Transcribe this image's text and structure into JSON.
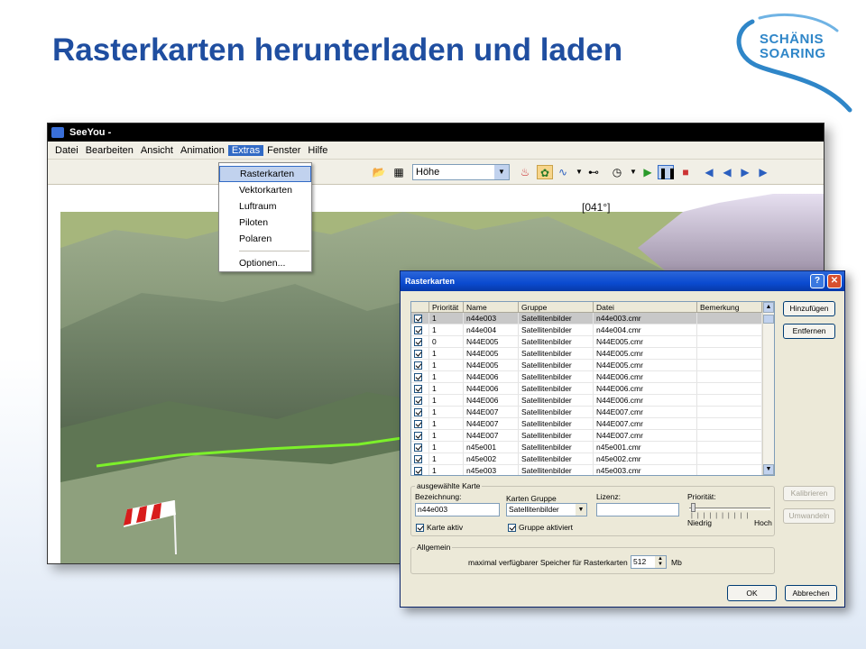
{
  "slide": {
    "title": "Rasterkarten herunterladen und laden",
    "logo_line1": "SCHÄNIS",
    "logo_line2": "SOARING"
  },
  "app": {
    "title": "SeeYou -",
    "menu": [
      "Datei",
      "Bearbeiten",
      "Ansicht",
      "Animation",
      "Extras",
      "Fenster",
      "Hilfe"
    ],
    "active_menu": "Extras",
    "toolbar_select_value": "Höhe",
    "compass_label": "[041°]"
  },
  "extras_menu": {
    "items": [
      "Rasterkarten",
      "Vektorkarten",
      "Luftraum",
      "Piloten",
      "Polaren"
    ],
    "after_separator": "Optionen...",
    "highlighted": "Rasterkarten"
  },
  "dialog": {
    "title": "Rasterkarten",
    "help_button": "?",
    "close_button": "✕",
    "columns": [
      "",
      "Priorität",
      "Name",
      "Gruppe",
      "Datei",
      "Bemerkung"
    ],
    "rows": [
      {
        "checked": true,
        "prio": "1",
        "name": "n44e003",
        "gruppe": "Satellitenbilder",
        "datei": "n44e003.cmr",
        "bemerkung": ""
      },
      {
        "checked": true,
        "prio": "1",
        "name": "n44e004",
        "gruppe": "Satellitenbilder",
        "datei": "n44e004.cmr",
        "bemerkung": ""
      },
      {
        "checked": true,
        "prio": "0",
        "name": "N44E005",
        "gruppe": "Satellitenbilder",
        "datei": "N44E005.cmr",
        "bemerkung": ""
      },
      {
        "checked": true,
        "prio": "1",
        "name": "N44E005",
        "gruppe": "Satellitenbilder",
        "datei": "N44E005.cmr",
        "bemerkung": ""
      },
      {
        "checked": true,
        "prio": "1",
        "name": "N44E005",
        "gruppe": "Satellitenbilder",
        "datei": "N44E005.cmr",
        "bemerkung": ""
      },
      {
        "checked": true,
        "prio": "1",
        "name": "N44E006",
        "gruppe": "Satellitenbilder",
        "datei": "N44E006.cmr",
        "bemerkung": ""
      },
      {
        "checked": true,
        "prio": "1",
        "name": "N44E006",
        "gruppe": "Satellitenbilder",
        "datei": "N44E006.cmr",
        "bemerkung": ""
      },
      {
        "checked": true,
        "prio": "1",
        "name": "N44E006",
        "gruppe": "Satellitenbilder",
        "datei": "N44E006.cmr",
        "bemerkung": ""
      },
      {
        "checked": true,
        "prio": "1",
        "name": "N44E007",
        "gruppe": "Satellitenbilder",
        "datei": "N44E007.cmr",
        "bemerkung": ""
      },
      {
        "checked": true,
        "prio": "1",
        "name": "N44E007",
        "gruppe": "Satellitenbilder",
        "datei": "N44E007.cmr",
        "bemerkung": ""
      },
      {
        "checked": true,
        "prio": "1",
        "name": "N44E007",
        "gruppe": "Satellitenbilder",
        "datei": "N44E007.cmr",
        "bemerkung": ""
      },
      {
        "checked": true,
        "prio": "1",
        "name": "n45e001",
        "gruppe": "Satellitenbilder",
        "datei": "n45e001.cmr",
        "bemerkung": ""
      },
      {
        "checked": true,
        "prio": "1",
        "name": "n45e002",
        "gruppe": "Satellitenbilder",
        "datei": "n45e002.cmr",
        "bemerkung": ""
      },
      {
        "checked": true,
        "prio": "1",
        "name": "n45e003",
        "gruppe": "Satellitenbilder",
        "datei": "n45e003.cmr",
        "bemerkung": ""
      }
    ],
    "selected_row": 0,
    "buttons": {
      "add": "Hinzufügen",
      "remove": "Entfernen",
      "calibrate": "Kalibrieren",
      "convert": "Umwandeln",
      "ok": "OK",
      "cancel": "Abbrechen"
    },
    "selected_map": {
      "group_label": "ausgewählte Karte",
      "name_label": "Bezeichnung:",
      "name_value": "n44e003",
      "group_field_label": "Karten Gruppe",
      "group_value": "Satellitenbilder",
      "license_label": "Lizenz:",
      "license_value": "",
      "priority_label": "Priorität:",
      "priority_low": "Niedrig",
      "priority_high": "Hoch",
      "map_active_label": "Karte aktiv",
      "map_active": true,
      "group_active_label": "Gruppe aktiviert",
      "group_active": true
    },
    "general": {
      "group_label": "Allgemein",
      "memory_label": "maximal verfügbarer Speicher für Rasterkarten",
      "memory_value": "512",
      "memory_unit": "Mb"
    }
  }
}
